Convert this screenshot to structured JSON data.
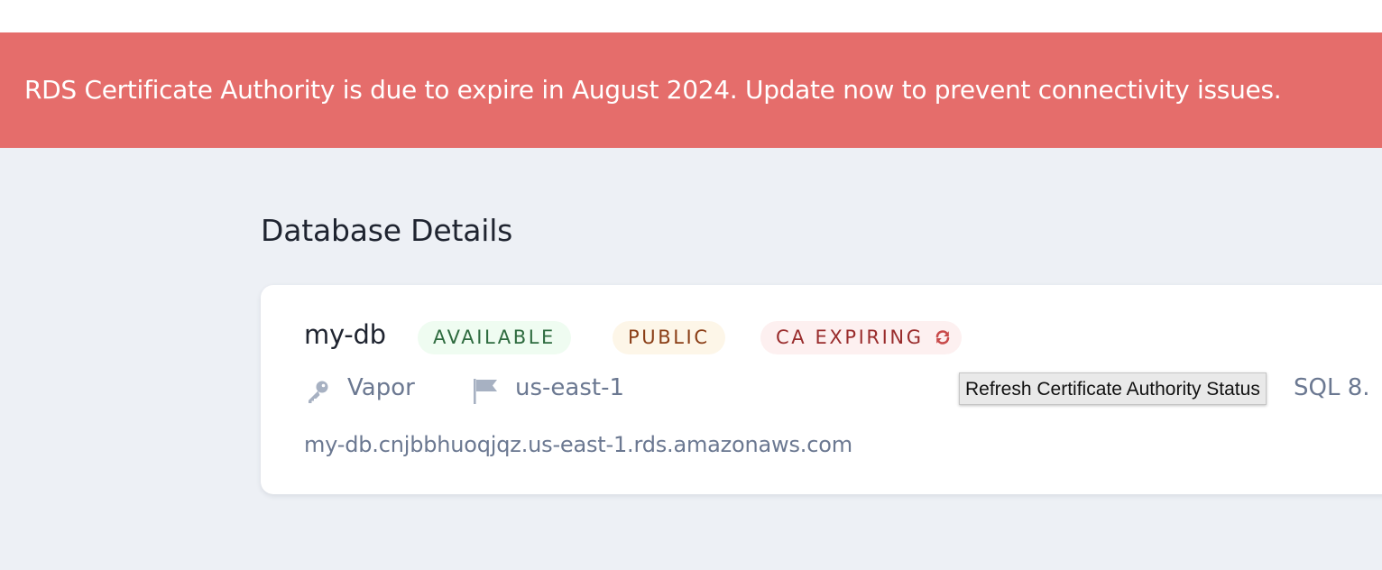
{
  "banner": {
    "message": "RDS Certificate Authority is due to expire in August 2024. Update now to prevent connectivity issues.",
    "color": "#e56d6b"
  },
  "page": {
    "title": "Database Details"
  },
  "database": {
    "name": "my-db",
    "badges": {
      "status": "AVAILABLE",
      "visibility": "PUBLIC",
      "ca": "CA EXPIRING"
    },
    "network": "Vapor",
    "region": "us-east-1",
    "engine_partial": "SQL 8.",
    "endpoint": "my-db.cnjbbhuoqjqz.us-east-1.rds.amazonaws.com"
  },
  "icons": {
    "network": "key-icon",
    "region": "flag-icon",
    "refresh": "refresh-icon"
  },
  "tooltip": {
    "text": "Refresh Certificate Authority Status"
  },
  "colors": {
    "available_bg": "#effcf1",
    "available_text": "#2e6b3f",
    "public_bg": "#fdf6e8",
    "public_text": "#8a3e16",
    "ca_bg": "#fdf0f0",
    "ca_text": "#992c2c"
  }
}
